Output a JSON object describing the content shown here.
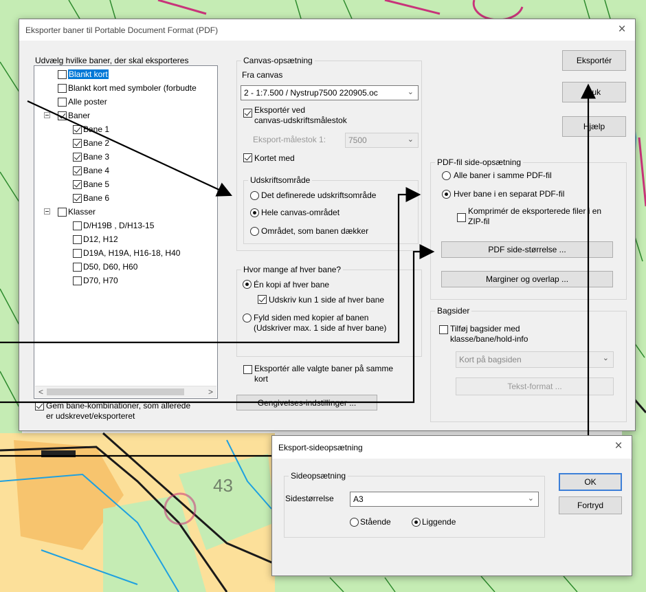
{
  "main_dialog": {
    "title": "Eksporter baner til Portable Document Format (PDF)",
    "close_glyph": "×",
    "courses_group": {
      "legend": "Udvælg hvilke baner, der skal eksporteres",
      "items": [
        {
          "label": "Blankt kort",
          "checked": false,
          "highlight": true
        },
        {
          "label": "Blankt kort med symboler (forbudte",
          "checked": false
        },
        {
          "label": "Alle poster",
          "checked": false
        },
        {
          "label": "Baner",
          "checked": true
        },
        {
          "label": "Bane 1",
          "checked": true
        },
        {
          "label": "Bane 2",
          "checked": true
        },
        {
          "label": "Bane 3",
          "checked": true
        },
        {
          "label": "Bane 4",
          "checked": true
        },
        {
          "label": "Bane 5",
          "checked": true
        },
        {
          "label": "Bane 6",
          "checked": true
        },
        {
          "label": "Klasser",
          "checked": false
        },
        {
          "label": "D/H19B , D/H13-15",
          "checked": false
        },
        {
          "label": "D12, H12",
          "checked": false
        },
        {
          "label": "D19A, H19A, H16-18, H40",
          "checked": false
        },
        {
          "label": "D50, D60, H60",
          "checked": false
        },
        {
          "label": "D70, H70",
          "checked": false
        }
      ],
      "scroll_left": "<",
      "scroll_right": ">"
    },
    "remember_combinations": {
      "line1": "Gem bane-kombinationer, som allerede",
      "line2": "er udskrevet/eksporteret",
      "checked": true
    },
    "canvas_group": {
      "legend": "Canvas-opsætning",
      "from_canvas_label": "Fra canvas",
      "canvas_value": "2 - 1:7.500 / Nystrup7500  220905.oc",
      "export_at_print_scale": {
        "line1": "Eksportér ved",
        "line2": "canvas-udskriftsmålestok",
        "checked": true
      },
      "export_scale_label": "Eksport-målestok  1:",
      "export_scale_value": "7500",
      "map_included": {
        "label": "Kortet med",
        "checked": true
      }
    },
    "print_area_group": {
      "legend": "Udskriftsområde",
      "options": [
        {
          "label": "Det definerede udskriftsområde",
          "selected": false
        },
        {
          "label": "Hele canvas-området",
          "selected": true
        },
        {
          "label": "Området, som banen dækker",
          "selected": false
        }
      ]
    },
    "copies_group": {
      "legend": "Hvor mange af hver bane?",
      "one_copy": {
        "label": "Én kopi af hver bane",
        "selected": true
      },
      "one_page": {
        "label": "Udskriv kun 1 side af hver bane",
        "checked": true
      },
      "fill_page": {
        "line1": "Fyld siden med kopier af banen",
        "line2": "(Udskriver max. 1 side af hver bane)",
        "selected": false
      }
    },
    "export_all_same_map": {
      "line1": "Eksportér alle valgte baner på samme",
      "line2": "kort",
      "checked": false
    },
    "render_settings_button": "Gengivelses-indstillinger ...",
    "buttons": {
      "export": "Eksportér",
      "close": "Luk",
      "help": "Hjælp"
    },
    "pdf_page_setup_group": {
      "legend": "PDF-fil side-opsætning",
      "all_in_one": {
        "label": "Alle baner i samme PDF-fil",
        "selected": false
      },
      "separate": {
        "label": "Hver bane i en separat PDF-fil",
        "selected": true
      },
      "zip": {
        "line1": "Komprimér de eksporterede filer i en",
        "line2": "ZIP-fil",
        "checked": false
      },
      "page_size_button": "PDF side-størrelse ...",
      "margins_button": "Marginer og overlap ..."
    },
    "back_pages_group": {
      "legend": "Bagsider",
      "add_back_pages": {
        "line1": "Tilføj bagsider med",
        "line2": "klasse/bane/hold-info",
        "checked": false
      },
      "back_page_select": "Kort på bagsiden",
      "text_format_button": "Tekst-format ..."
    }
  },
  "page_dialog": {
    "title": "Eksport-sideopsætning",
    "close_glyph": "×",
    "group_legend": "Sideopsætning",
    "size_label": "Sidestørrelse",
    "size_value": "A3",
    "portrait": {
      "label": "Stående",
      "selected": false
    },
    "landscape": {
      "label": "Liggende",
      "selected": true
    },
    "ok": "OK",
    "cancel": "Fortryd"
  },
  "colors": {
    "map_green": "#c5ecb4",
    "map_orange": "#f7c46e",
    "map_yellow": "#fce09a",
    "course_magenta": "#c8347a",
    "water_blue": "#1ea0e0",
    "selection_blue": "#0078d7"
  }
}
